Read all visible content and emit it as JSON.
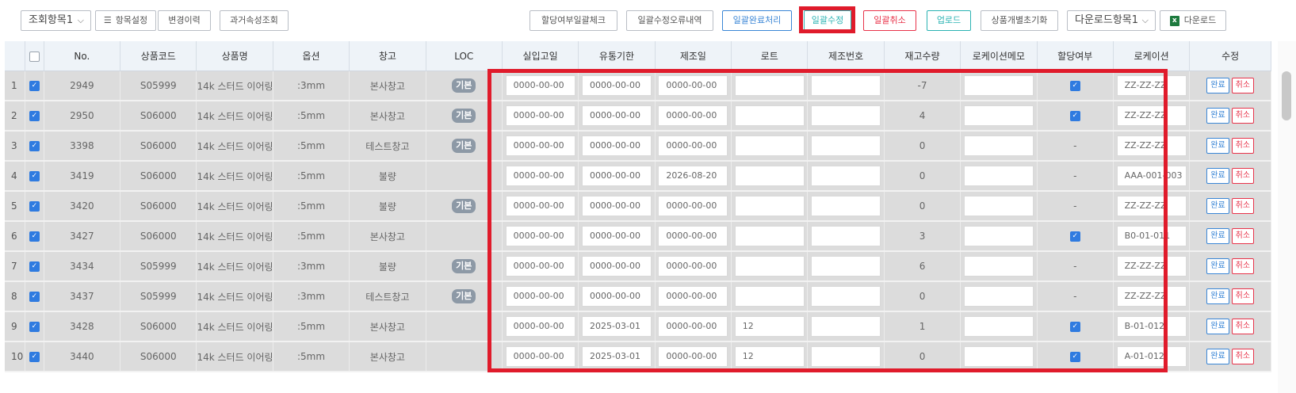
{
  "toolbar": {
    "view_select": "조회항목1",
    "settings_btn": "항목설정",
    "history_btn": "변경이력",
    "past_attr_btn": "과거속성조회",
    "alloc_check_btn": "할당여부일괄체크",
    "bulk_error_btn": "일괄수정오류내역",
    "bulk_done_btn": "일괄완료처리",
    "bulk_edit_btn": "일괄수정",
    "bulk_cancel_btn": "일괄취소",
    "upload_btn": "업로드",
    "reset_btn": "상품개별초기화",
    "download_select": "다운로드항목1",
    "download_btn": "다운로드"
  },
  "columns": [
    "",
    "",
    "No.",
    "상품코드",
    "상품명",
    "옵션",
    "창고",
    "LOC",
    "실입고일",
    "유통기한",
    "제조일",
    "로트",
    "제조번호",
    "재고수량",
    "로케이션메모",
    "할당여부",
    "로케이션",
    "수정"
  ],
  "actions": {
    "ok": "완료",
    "cancel": "취소"
  },
  "rows": [
    {
      "idx": "1",
      "no": "2949",
      "code": "S05999",
      "name": "14k 스터드 이어링",
      "opt": ":3mm",
      "wh": "본사창고",
      "loc": "기본",
      "in": "0000-00-00",
      "exp": "0000-00-00",
      "mfg": "0000-00-00",
      "lot": "",
      "mno": "",
      "qty": "-7",
      "memo": "",
      "alloc": true,
      "locn": "ZZ-ZZ-ZZ"
    },
    {
      "idx": "2",
      "no": "2950",
      "code": "S06000",
      "name": "14k 스터드 이어링",
      "opt": ":5mm",
      "wh": "본사창고",
      "loc": "기본",
      "in": "0000-00-00",
      "exp": "0000-00-00",
      "mfg": "0000-00-00",
      "lot": "",
      "mno": "",
      "qty": "4",
      "memo": "",
      "alloc": true,
      "locn": "ZZ-ZZ-ZZ"
    },
    {
      "idx": "3",
      "no": "3398",
      "code": "S06000",
      "name": "14k 스터드 이어링",
      "opt": ":5mm",
      "wh": "테스트창고",
      "loc": "기본",
      "in": "0000-00-00",
      "exp": "0000-00-00",
      "mfg": "0000-00-00",
      "lot": "",
      "mno": "",
      "qty": "0",
      "memo": "",
      "alloc": false,
      "locn": "ZZ-ZZ-ZZ"
    },
    {
      "idx": "4",
      "no": "3419",
      "code": "S06000",
      "name": "14k 스터드 이어링",
      "opt": ":5mm",
      "wh": "불량",
      "loc": "",
      "in": "0000-00-00",
      "exp": "0000-00-00",
      "mfg": "2026-08-20",
      "lot": "",
      "mno": "",
      "qty": "0",
      "memo": "",
      "alloc": false,
      "locn": "AAA-001-003"
    },
    {
      "idx": "5",
      "no": "3420",
      "code": "S06000",
      "name": "14k 스터드 이어링",
      "opt": ":5mm",
      "wh": "불량",
      "loc": "기본",
      "in": "0000-00-00",
      "exp": "0000-00-00",
      "mfg": "0000-00-00",
      "lot": "",
      "mno": "",
      "qty": "0",
      "memo": "",
      "alloc": false,
      "locn": "ZZ-ZZ-ZZ"
    },
    {
      "idx": "6",
      "no": "3427",
      "code": "S06000",
      "name": "14k 스터드 이어링",
      "opt": ":5mm",
      "wh": "본사창고",
      "loc": "",
      "in": "0000-00-00",
      "exp": "0000-00-00",
      "mfg": "0000-00-00",
      "lot": "",
      "mno": "",
      "qty": "3",
      "memo": "",
      "alloc": true,
      "locn": "B0-01-011"
    },
    {
      "idx": "7",
      "no": "3434",
      "code": "S05999",
      "name": "14k 스터드 이어링",
      "opt": ":3mm",
      "wh": "불량",
      "loc": "기본",
      "in": "0000-00-00",
      "exp": "0000-00-00",
      "mfg": "0000-00-00",
      "lot": "",
      "mno": "",
      "qty": "6",
      "memo": "",
      "alloc": false,
      "locn": "ZZ-ZZ-ZZ"
    },
    {
      "idx": "8",
      "no": "3437",
      "code": "S05999",
      "name": "14k 스터드 이어링",
      "opt": ":3mm",
      "wh": "테스트창고",
      "loc": "기본",
      "in": "0000-00-00",
      "exp": "0000-00-00",
      "mfg": "0000-00-00",
      "lot": "",
      "mno": "",
      "qty": "0",
      "memo": "",
      "alloc": false,
      "locn": "ZZ-ZZ-ZZ"
    },
    {
      "idx": "9",
      "no": "3428",
      "code": "S06000",
      "name": "14k 스터드 이어링",
      "opt": ":5mm",
      "wh": "본사창고",
      "loc": "",
      "in": "0000-00-00",
      "exp": "2025-03-01",
      "mfg": "0000-00-00",
      "lot": "12",
      "mno": "",
      "qty": "1",
      "memo": "",
      "alloc": true,
      "locn": "B-01-012"
    },
    {
      "idx": "10",
      "no": "3440",
      "code": "S06000",
      "name": "14k 스터드 이어링",
      "opt": ":5mm",
      "wh": "본사창고",
      "loc": "",
      "in": "0000-00-00",
      "exp": "2025-03-01",
      "mfg": "0000-00-00",
      "lot": "12",
      "mno": "",
      "qty": "0",
      "memo": "",
      "alloc": true,
      "locn": "A-01-012"
    }
  ],
  "alloc_none_text": "-",
  "colors": {
    "accent_blue": "#2f7be0",
    "highlight_red": "#e01b2b",
    "header_bg": "#eef3f8",
    "row_bg": "#dcdcdc"
  }
}
